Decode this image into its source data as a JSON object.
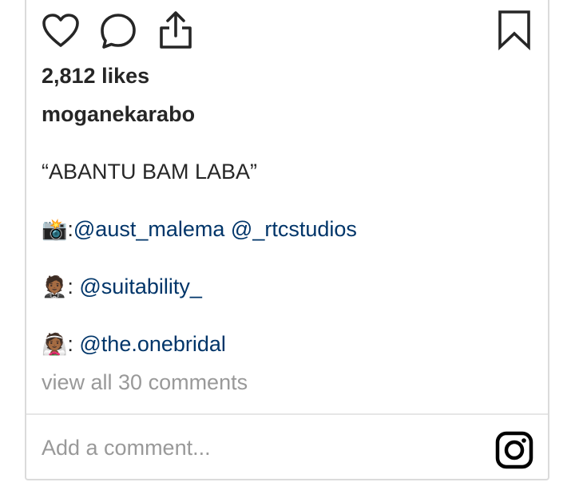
{
  "post": {
    "likes_text": "2,812 likes",
    "username": "moganekarabo",
    "caption": {
      "title": "“ABANTU BAM LABA”",
      "credits": [
        {
          "emoji": "📸",
          "separator": ":",
          "mentions": [
            "@aust_malema",
            "@_rtcstudios"
          ]
        },
        {
          "emoji": "🤵🏾",
          "separator": ": ",
          "mentions": [
            "@suitability_"
          ]
        },
        {
          "emoji": "👰🏾",
          "separator": ": ",
          "mentions": [
            "@the.onebridal"
          ]
        }
      ]
    },
    "view_all_comments": "view all 30 comments",
    "comment_placeholder": "Add a comment..."
  },
  "icons": {
    "like": "heart-icon",
    "comment": "comment-bubble-icon",
    "share": "share-upload-icon",
    "save": "bookmark-icon",
    "camera": "instagram-camera-icon"
  },
  "colors": {
    "text": "#262626",
    "mention": "#003569",
    "muted": "#999999",
    "border": "#dbdbdb"
  }
}
